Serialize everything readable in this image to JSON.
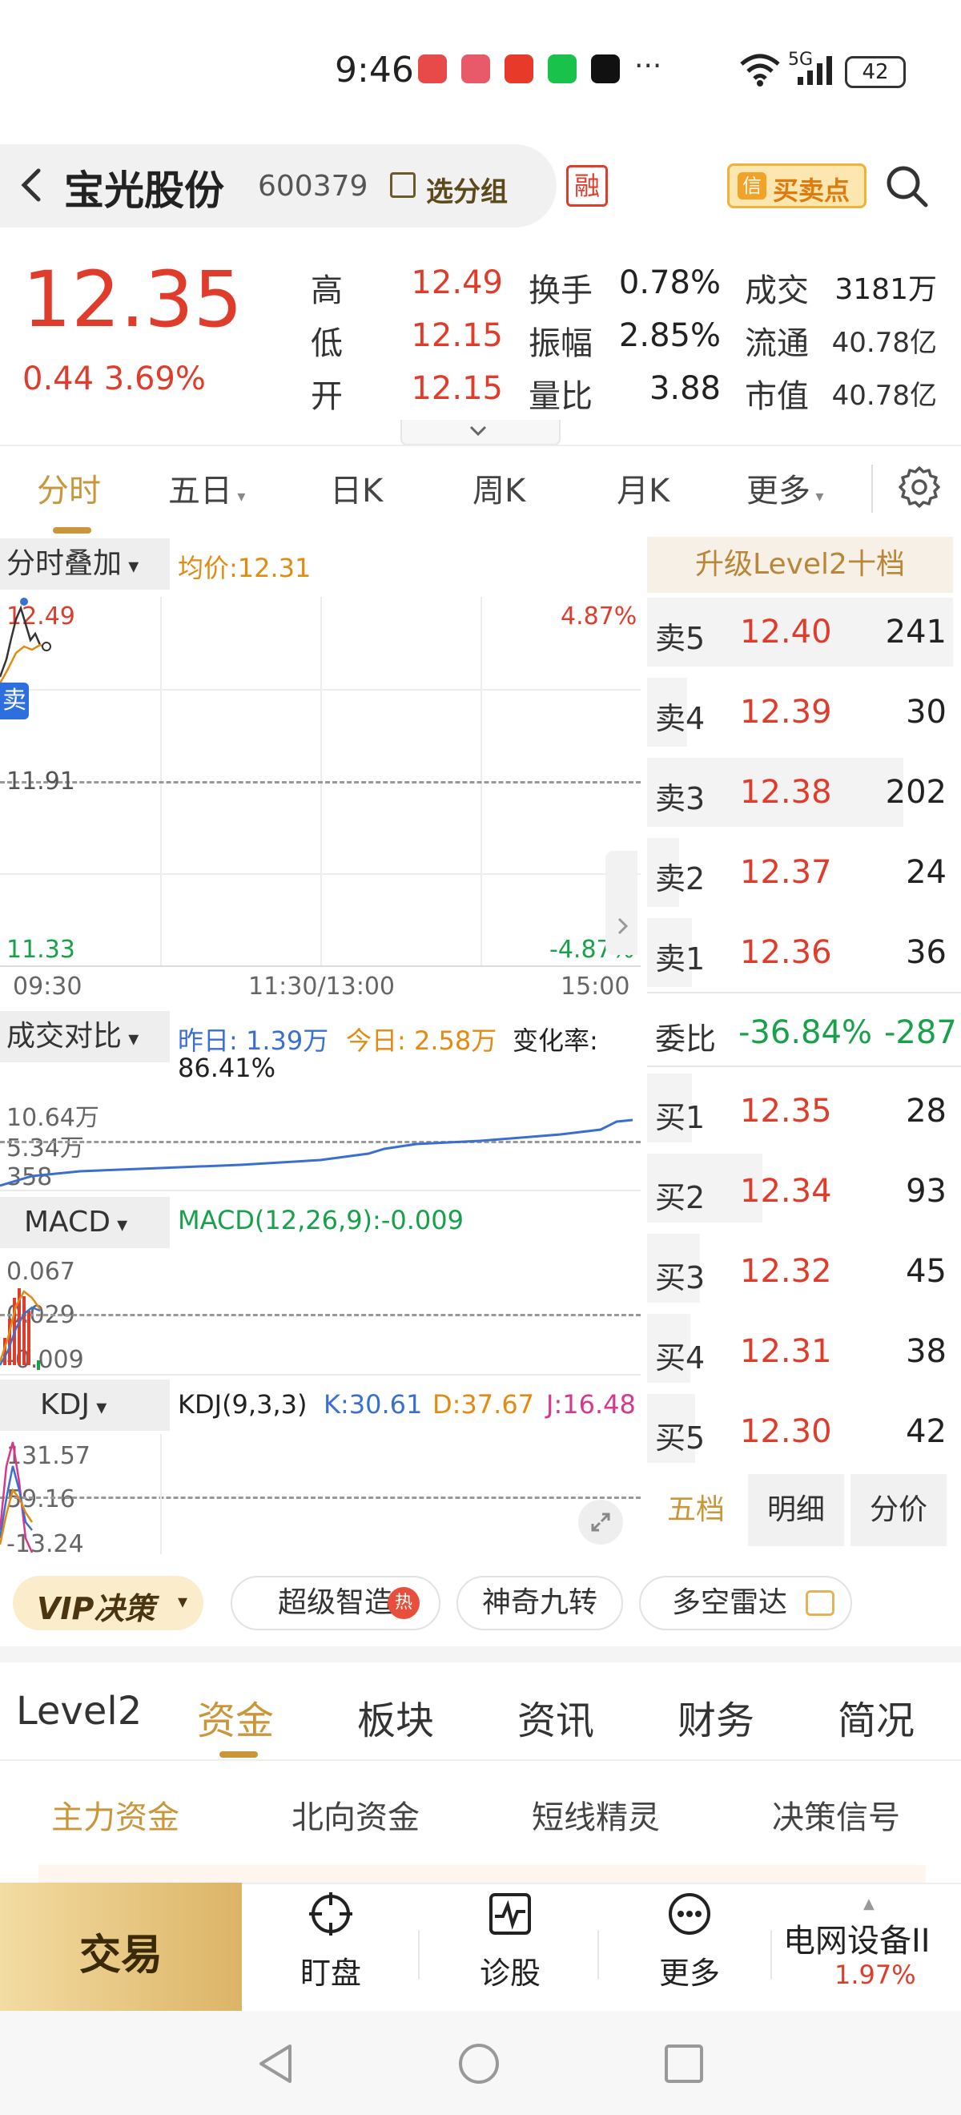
{
  "status_bar": {
    "time": "9:46",
    "dots": "···",
    "network": "5G",
    "battery": "42"
  },
  "header": {
    "name": "宝光股份",
    "code": "600379",
    "group_label": "选分组",
    "margin_badge": "融",
    "buy_sell_label": "买卖点",
    "buy_sell_icon_text": "信"
  },
  "quote": {
    "price": "12.35",
    "change": "0.44 3.69%",
    "high_label": "高",
    "high": "12.49",
    "low_label": "低",
    "low": "12.15",
    "open_label": "开",
    "open": "12.15",
    "turnover_label": "换手",
    "turnover": "0.78%",
    "amplitude_label": "振幅",
    "amplitude": "2.85%",
    "volume_ratio_label": "量比",
    "volume_ratio": "3.88",
    "amount_label": "成交",
    "amount": "3181万",
    "float_label": "流通",
    "float_cap": "40.78亿",
    "mktcap_label": "市值",
    "mktcap": "40.78亿"
  },
  "chart_tabs": {
    "intraday": "分时",
    "five_day": "五日",
    "daily": "日K",
    "weekly": "周K",
    "monthly": "月K",
    "more": "更多"
  },
  "intraday": {
    "overlay_label": "分时叠加",
    "avg_label": "均价:12.31",
    "y_top": "12.49",
    "y_mid": "11.91",
    "y_bottom": "11.33",
    "pct_top": "4.87%",
    "pct_bottom": "-4.87%",
    "sell_marker": "卖",
    "time_start": "09:30",
    "time_mid": "11:30/13:00",
    "time_end": "15:00"
  },
  "volume_compare": {
    "label": "成交对比",
    "yesterday": "昨日: 1.39万",
    "today": "今日: 2.58万",
    "change_rate": "变化率:",
    "change_rate_value": "86.41%",
    "y1": "10.64万",
    "y2": "5.34万",
    "y3": "358"
  },
  "macd": {
    "label": "MACD",
    "value": "MACD(12,26,9):-0.009",
    "y1": "0.067",
    "y2": "0.029",
    "y3": "-0.009"
  },
  "kdj": {
    "label": "KDJ",
    "params": "KDJ(9,3,3)",
    "k": "K:30.61",
    "d": "D:37.67",
    "j": "J:16.48",
    "y1": "131.57",
    "y2": "59.16",
    "y3": "-13.24"
  },
  "colors": {
    "up": "#e03c2c",
    "down": "#19a04a",
    "accent": "#c9963a",
    "avg_line": "#e38a12",
    "price_line": "#3a6fd1"
  },
  "order_book": {
    "upgrade": "升级Level2十档",
    "asks": [
      {
        "label": "卖5",
        "price": "12.40",
        "volume": "241"
      },
      {
        "label": "卖4",
        "price": "12.39",
        "volume": "30"
      },
      {
        "label": "卖3",
        "price": "12.38",
        "volume": "202"
      },
      {
        "label": "卖2",
        "price": "12.37",
        "volume": "24"
      },
      {
        "label": "卖1",
        "price": "12.36",
        "volume": "36"
      }
    ],
    "commission_label": "委比",
    "commission_value": "-36.84%",
    "commission_volume": "-287",
    "bids": [
      {
        "label": "买1",
        "price": "12.35",
        "volume": "28"
      },
      {
        "label": "买2",
        "price": "12.34",
        "volume": "93"
      },
      {
        "label": "买3",
        "price": "12.32",
        "volume": "45"
      },
      {
        "label": "买4",
        "price": "12.31",
        "volume": "38"
      },
      {
        "label": "买5",
        "price": "12.30",
        "volume": "42"
      }
    ],
    "tabs": [
      "五档",
      "明细",
      "分价"
    ]
  },
  "chips": {
    "vip": "VIP决策",
    "smart": "超级智造",
    "hot": "热",
    "nine": "神奇九转",
    "radar": "多空雷达"
  },
  "info_tabs": [
    "Level2",
    "资金",
    "板块",
    "资讯",
    "财务",
    "简况"
  ],
  "sub_tabs": [
    "主力资金",
    "北向资金",
    "短线精灵",
    "决策信号"
  ],
  "bottom_bar": {
    "trade": "交易",
    "watch": "盯盘",
    "diagnose": "诊股",
    "more": "更多",
    "sector": "电网设备II",
    "sector_change": "1.97%"
  }
}
